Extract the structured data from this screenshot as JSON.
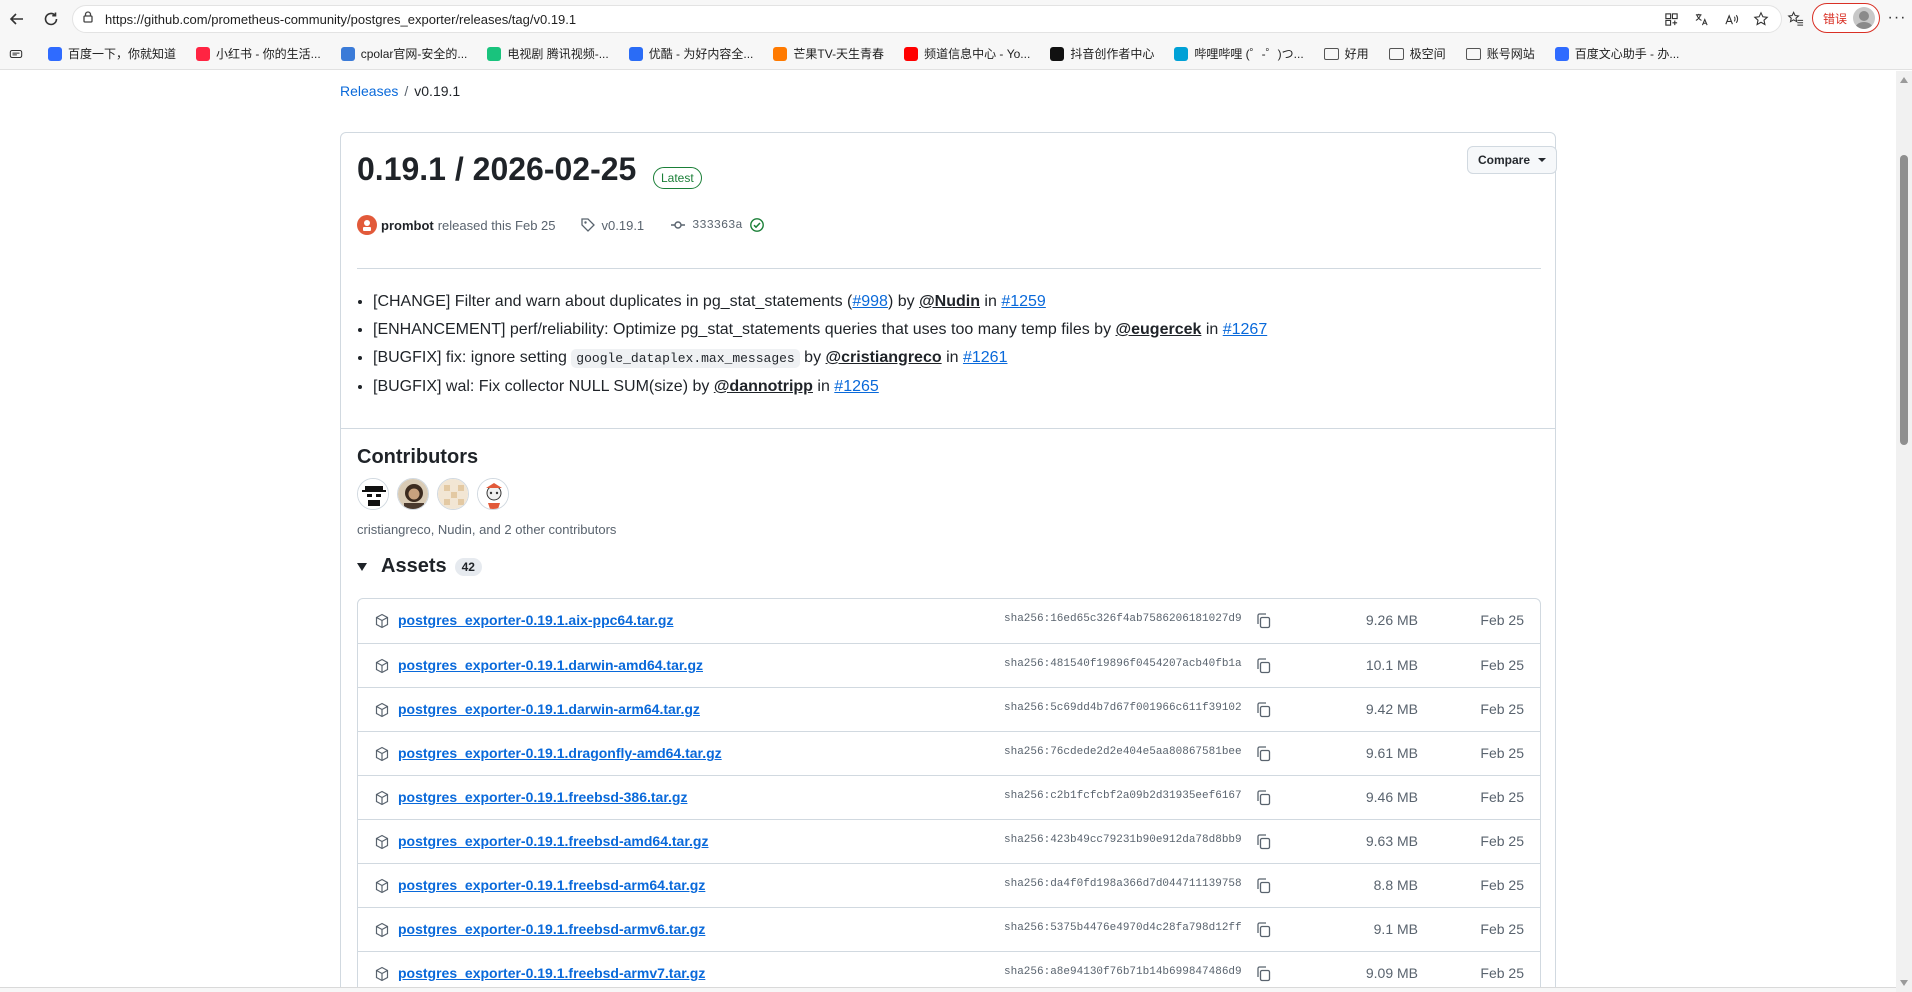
{
  "browser": {
    "url": "https://github.com/prometheus-community/postgres_exporter/releases/tag/v0.19.1",
    "error_label": "错误"
  },
  "bookmarks": [
    {
      "label": "百度一下，你就知道",
      "color": "#2f6bff"
    },
    {
      "label": "小红书 - 你的生活...",
      "color": "#ff2442"
    },
    {
      "label": "cpolar官网-安全的...",
      "color": "#3b7bd8"
    },
    {
      "label": "电视剧 腾讯视频-...",
      "color": "#19c37d"
    },
    {
      "label": "优酷 - 为好内容全...",
      "color": "#2a6cf6"
    },
    {
      "label": "芒果TV-天生青春",
      "color": "#ff7a00"
    },
    {
      "label": "频道信息中心 - Yo...",
      "color": "#ff0000"
    },
    {
      "label": "抖音创作者中心",
      "color": "#111111"
    },
    {
      "label": "哔哩哔哩 (゜-゜)つ...",
      "color": "#00a1d6"
    },
    {
      "label": "好用",
      "folder": true
    },
    {
      "label": "极空间",
      "folder": true
    },
    {
      "label": "账号网站",
      "folder": true
    },
    {
      "label": "百度文心助手 - 办...",
      "color": "#2f6bff"
    }
  ],
  "breadcrumb": {
    "releases": "Releases",
    "separator": "/",
    "current": "v0.19.1"
  },
  "release": {
    "title": "0.19.1 / 2026-02-25",
    "badge": "Latest",
    "compare_label": "Compare",
    "author": "prombot",
    "released_text": "released this Feb 25",
    "tag": "v0.19.1",
    "commit": "333363a",
    "notes": [
      {
        "pre": "[CHANGE] Filter and warn about duplicates in pg_stat_statements (",
        "link1": "#998",
        "mid": ") by ",
        "user": "@Nudin",
        "in": " in ",
        "pr": "#1259"
      },
      {
        "pre": "[ENHANCEMENT] perf/reliability: Optimize pg_stat_statements queries that uses too many temp files by ",
        "user": "@eugercek",
        "in": " in ",
        "pr": "#1267"
      },
      {
        "pre": "[BUGFIX] fix: ignore setting ",
        "code": "google_dataplex.max_messages",
        "mid": " by ",
        "user": "@cristiangreco",
        "in": " in ",
        "pr": "#1261"
      },
      {
        "pre": "[BUGFIX] wal: Fix collector NULL SUM(size) by ",
        "user": "@dannotripp",
        "in": " in ",
        "pr": "#1265"
      }
    ]
  },
  "contributors": {
    "title": "Contributors",
    "summary": "cristiangreco, Nudin, and 2 other contributors"
  },
  "assets": {
    "title": "Assets",
    "count": "42",
    "items": [
      {
        "name": "postgres_exporter-0.19.1.aix-ppc64.tar.gz",
        "sha": "sha256:16ed65c326f4ab7586206181027d9",
        "size": "9.26 MB",
        "date": "Feb 25"
      },
      {
        "name": "postgres_exporter-0.19.1.darwin-amd64.tar.gz",
        "sha": "sha256:481540f19896f0454207acb40fb1a",
        "size": "10.1 MB",
        "date": "Feb 25"
      },
      {
        "name": "postgres_exporter-0.19.1.darwin-arm64.tar.gz",
        "sha": "sha256:5c69dd4b7d67f001966c611f39102",
        "size": "9.42 MB",
        "date": "Feb 25"
      },
      {
        "name": "postgres_exporter-0.19.1.dragonfly-amd64.tar.gz",
        "sha": "sha256:76cdede2d2e404e5aa80867581bee",
        "size": "9.61 MB",
        "date": "Feb 25"
      },
      {
        "name": "postgres_exporter-0.19.1.freebsd-386.tar.gz",
        "sha": "sha256:c2b1fcfcbf2a09b2d31935eef6167",
        "size": "9.46 MB",
        "date": "Feb 25"
      },
      {
        "name": "postgres_exporter-0.19.1.freebsd-amd64.tar.gz",
        "sha": "sha256:423b49cc79231b90e912da78d8bb9",
        "size": "9.63 MB",
        "date": "Feb 25"
      },
      {
        "name": "postgres_exporter-0.19.1.freebsd-arm64.tar.gz",
        "sha": "sha256:da4f0fd198a366d7d044711139758",
        "size": "8.8 MB",
        "date": "Feb 25"
      },
      {
        "name": "postgres_exporter-0.19.1.freebsd-armv6.tar.gz",
        "sha": "sha256:5375b4476e4970d4c28fa798d12ff",
        "size": "9.1 MB",
        "date": "Feb 25"
      },
      {
        "name": "postgres_exporter-0.19.1.freebsd-armv7.tar.gz",
        "sha": "sha256:a8e94130f76b71b14b699847486d9",
        "size": "9.09 MB",
        "date": "Feb 25"
      }
    ]
  }
}
